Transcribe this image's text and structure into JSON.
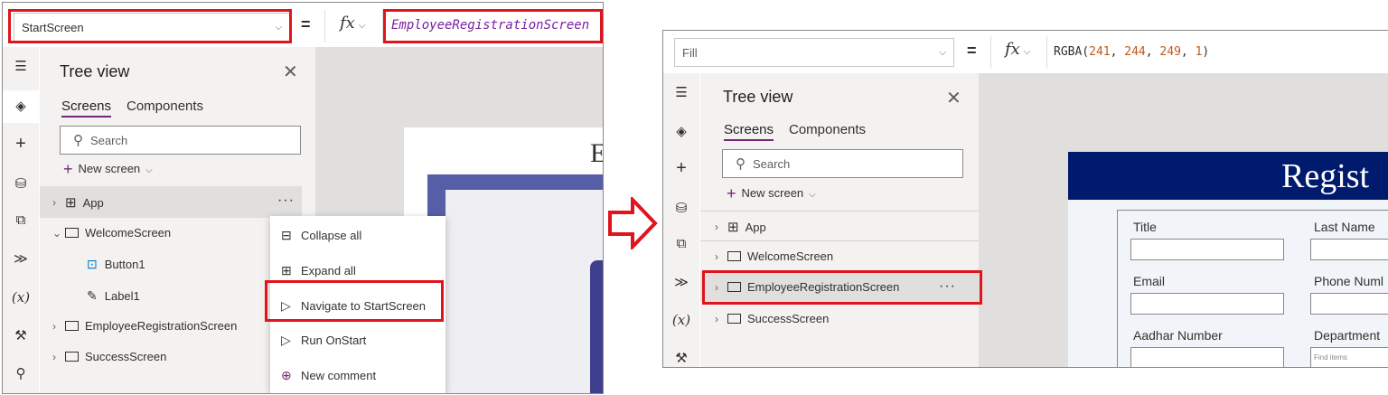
{
  "left": {
    "formula_bar": {
      "property": "StartScreen",
      "equals": "=",
      "fx": "fx",
      "formula": "EmployeeRegistrationScreen"
    },
    "tree_view": {
      "title": "Tree view",
      "tabs": [
        "Screens",
        "Components"
      ],
      "search_placeholder": "Search",
      "new_screen": "New screen",
      "nodes": {
        "app": "App",
        "welcome": "WelcomeScreen",
        "button1": "Button1",
        "label1": "Label1",
        "employee": "EmployeeRegistrationScreen",
        "success": "SuccessScreen"
      }
    },
    "context_menu": [
      "Collapse all",
      "Expand all",
      "Navigate to StartScreen",
      "Run OnStart",
      "New comment"
    ],
    "canvas_text": "E"
  },
  "right": {
    "formula_bar": {
      "property": "Fill",
      "equals": "=",
      "fx": "fx",
      "formula_fn": "RGBA(",
      "formula_args": [
        "241",
        "244",
        "249",
        "1"
      ],
      "formula_close": ")"
    },
    "tree_view": {
      "title": "Tree view",
      "tabs": [
        "Screens",
        "Components"
      ],
      "search_placeholder": "Search",
      "new_screen": "New screen",
      "nodes": {
        "app": "App",
        "welcome": "WelcomeScreen",
        "employee": "EmployeeRegistrationScreen",
        "success": "SuccessScreen"
      }
    },
    "form": {
      "header": "Regist",
      "fields": [
        "Title",
        "Last Name",
        "Email",
        "Phone Numl",
        "Aadhar Number",
        "Department"
      ],
      "dropdown_placeholder": "Find items"
    }
  },
  "colors": {
    "highlight": "#e1141c",
    "accent": "#742774",
    "header": "#001b6e",
    "form_bg": "#f1f4f9",
    "formula_purple": "#7a1fa2",
    "number_orange": "#c0581b"
  }
}
